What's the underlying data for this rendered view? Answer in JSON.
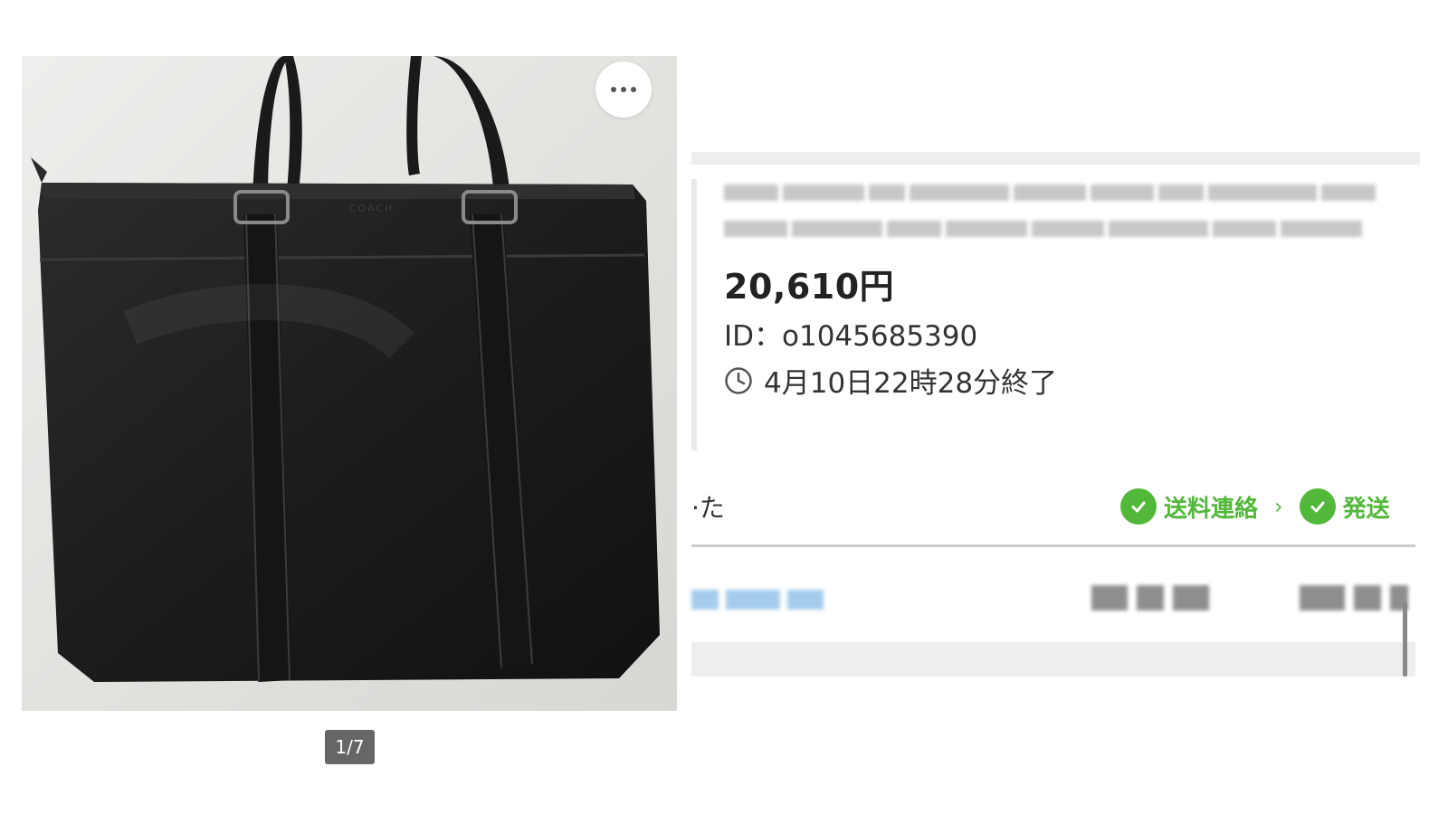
{
  "photo": {
    "alt_label": "",
    "brand_stamp": "COACH"
  },
  "gallery": {
    "pager": "1/7"
  },
  "listing": {
    "price": "20,610円",
    "id": "ID：o1045685390",
    "end_time": "4月10日22時28分終了",
    "status_partial": "·た"
  },
  "progress": {
    "steps": [
      {
        "label": "送料連絡",
        "done": true
      },
      {
        "label": "発送",
        "done": true
      }
    ],
    "accent_color": "#52b83a"
  },
  "icons": {
    "more": "more-horizontal-icon",
    "clock": "clock-icon",
    "check": "check-circle-icon",
    "arrow": "chevron-right-icon"
  }
}
